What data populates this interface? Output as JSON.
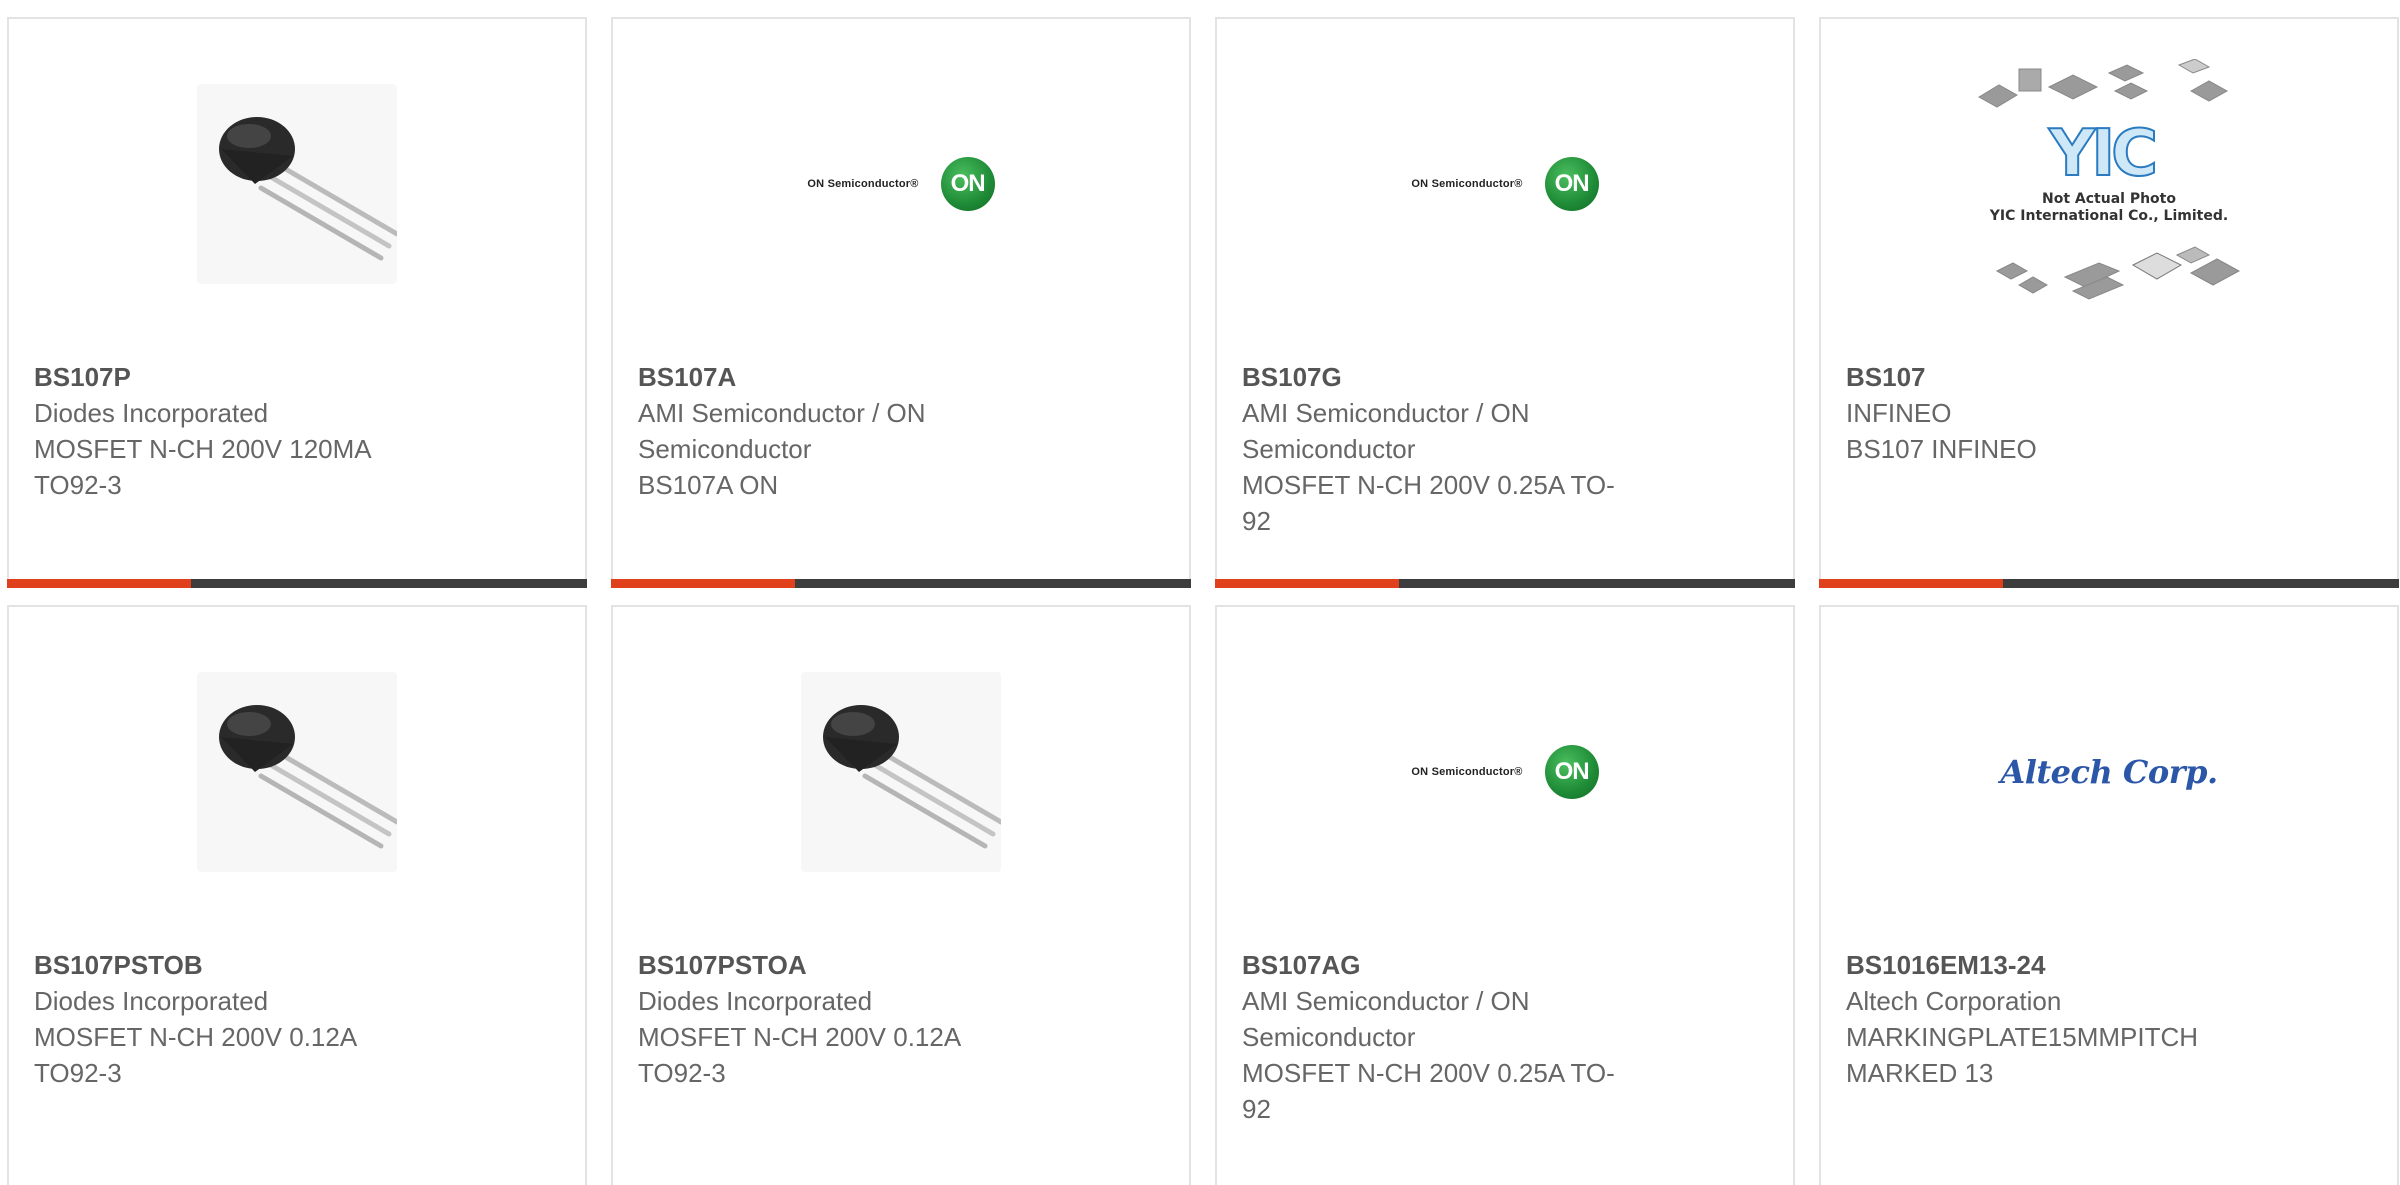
{
  "colors": {
    "accent": "#e0401c",
    "bar": "#3d3d3d",
    "border": "#e3e3e3",
    "text": "#666666"
  },
  "products": [
    {
      "part": "BS107P",
      "manufacturer": "Diodes Incorporated",
      "desc1": "MOSFET N-CH 200V 120MA",
      "desc2": "TO92-3",
      "image": "transistor-photo"
    },
    {
      "part": "BS107A",
      "manufacturer": "AMI Semiconductor / ON",
      "manufacturer2": "Semiconductor",
      "desc1": "BS107A ON",
      "image": "on-semiconductor-logo"
    },
    {
      "part": "BS107G",
      "manufacturer": "AMI Semiconductor / ON",
      "manufacturer2": "Semiconductor",
      "desc1": "MOSFET N-CH 200V 0.25A TO-",
      "desc2": "92",
      "image": "on-semiconductor-logo"
    },
    {
      "part": "BS107",
      "manufacturer": "INFINEO",
      "desc1": "BS107 INFINEO",
      "image": "yic-not-actual-photo"
    },
    {
      "part": "BS107PSTOB",
      "manufacturer": "Diodes Incorporated",
      "desc1": "MOSFET N-CH 200V 0.12A",
      "desc2": "TO92-3",
      "image": "transistor-photo"
    },
    {
      "part": "BS107PSTOA",
      "manufacturer": "Diodes Incorporated",
      "desc1": "MOSFET N-CH 200V 0.12A",
      "desc2": "TO92-3",
      "image": "transistor-photo"
    },
    {
      "part": "BS107AG",
      "manufacturer": "AMI Semiconductor / ON",
      "manufacturer2": "Semiconductor",
      "desc1": "MOSFET N-CH 200V 0.25A TO-",
      "desc2": "92",
      "image": "on-semiconductor-logo"
    },
    {
      "part": "BS1016EM13-24",
      "manufacturer": "Altech Corporation",
      "desc1": "MARKINGPLATE15MMPITCH",
      "desc2": "MARKED 13",
      "image": "altech-logo"
    }
  ],
  "logos": {
    "on_text": "ON Semiconductor®",
    "on_mark": "ON",
    "yic_mark": "YIC",
    "yic_caption1": "Not Actual Photo",
    "yic_caption2": "YIC International Co., Limited.",
    "altech": "Altech Corp."
  }
}
